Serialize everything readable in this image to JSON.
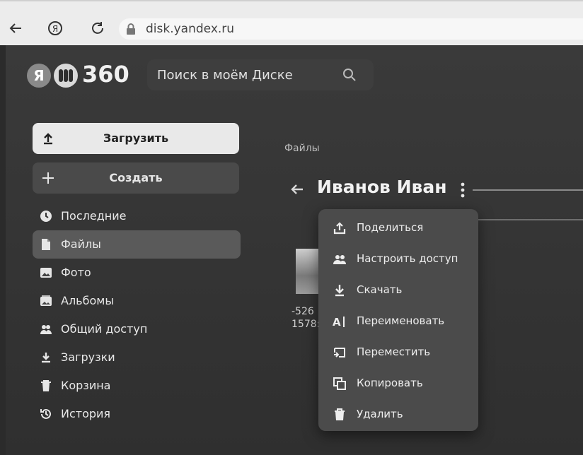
{
  "browser": {
    "back_icon": "back-arrow-icon",
    "yandex_icon": "yandex-icon",
    "reload_icon": "reload-icon",
    "url": "disk.yandex.ru"
  },
  "header": {
    "logo_letter": "Я",
    "logo_number": "360",
    "search_placeholder": "Поиск в моём Диске"
  },
  "sidebar": {
    "upload_label": "Загрузить",
    "create_label": "Создать",
    "items": [
      {
        "label": "Последние",
        "icon": "clock-icon"
      },
      {
        "label": "Файлы",
        "icon": "file-icon",
        "active": true
      },
      {
        "label": "Фото",
        "icon": "photo-icon"
      },
      {
        "label": "Альбомы",
        "icon": "albums-icon"
      },
      {
        "label": "Общий доступ",
        "icon": "shared-icon"
      },
      {
        "label": "Загрузки",
        "icon": "download-icon"
      },
      {
        "label": "Корзина",
        "icon": "trash-icon"
      },
      {
        "label": "История",
        "icon": "history-icon"
      }
    ]
  },
  "main": {
    "breadcrumb": "Файлы",
    "folder_title": "Иванов Иван",
    "file_name_line1": "-526",
    "file_name_line2": "1578:"
  },
  "context_menu": {
    "items": [
      {
        "label": "Поделиться",
        "icon": "share-icon"
      },
      {
        "label": "Настроить доступ",
        "icon": "access-icon"
      },
      {
        "label": "Скачать",
        "icon": "download-icon"
      },
      {
        "label": "Переименовать",
        "icon": "rename-icon"
      },
      {
        "label": "Переместить",
        "icon": "move-icon"
      },
      {
        "label": "Копировать",
        "icon": "copy-icon"
      },
      {
        "label": "Удалить",
        "icon": "delete-icon"
      }
    ]
  },
  "colors": {
    "background": "#2b2b2b",
    "menu": "#4b4b4b",
    "upload_button": "#e9e9e9"
  }
}
